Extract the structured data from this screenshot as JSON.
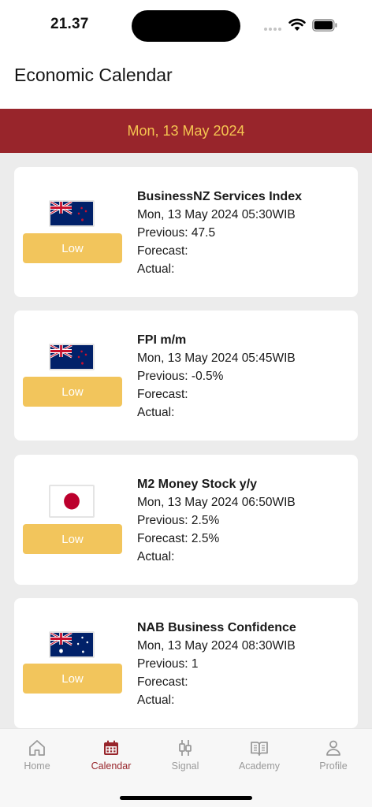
{
  "status_bar": {
    "time": "21.37"
  },
  "header": {
    "title": "Economic Calendar"
  },
  "date_band": {
    "label": "Mon, 13 May 2024"
  },
  "events": [
    {
      "country_flag": "new-zealand-flag",
      "impact": "Low",
      "title": "BusinessNZ Services Index",
      "datetime": "Mon, 13 May 2024 05:30WIB",
      "previous": "Previous: 47.5",
      "forecast": "Forecast:",
      "actual": "Actual:"
    },
    {
      "country_flag": "new-zealand-flag",
      "impact": "Low",
      "title": "FPI m/m",
      "datetime": "Mon, 13 May 2024 05:45WIB",
      "previous": "Previous: -0.5%",
      "forecast": "Forecast:",
      "actual": "Actual:"
    },
    {
      "country_flag": "japan-flag",
      "impact": "Low",
      "title": "M2 Money Stock y/y",
      "datetime": "Mon, 13 May 2024 06:50WIB",
      "previous": "Previous: 2.5%",
      "forecast": "Forecast: 2.5%",
      "actual": "Actual:"
    },
    {
      "country_flag": "australia-flag",
      "impact": "Low",
      "title": "NAB Business Confidence",
      "datetime": "Mon, 13 May 2024 08:30WIB",
      "previous": "Previous: 1",
      "forecast": "Forecast:",
      "actual": "Actual:"
    }
  ],
  "bottom_nav": [
    {
      "label": "Home",
      "icon": "home-icon",
      "active": false
    },
    {
      "label": "Calendar",
      "icon": "calendar-icon",
      "active": true
    },
    {
      "label": "Signal",
      "icon": "candlestick-icon",
      "active": false
    },
    {
      "label": "Academy",
      "icon": "book-icon",
      "active": false
    },
    {
      "label": "Profile",
      "icon": "person-icon",
      "active": false
    }
  ],
  "colors": {
    "brand_red": "#98252b",
    "accent_yellow": "#f5c451",
    "impact_low": "#f2c55c",
    "inactive_nav": "#9a9a9a"
  }
}
